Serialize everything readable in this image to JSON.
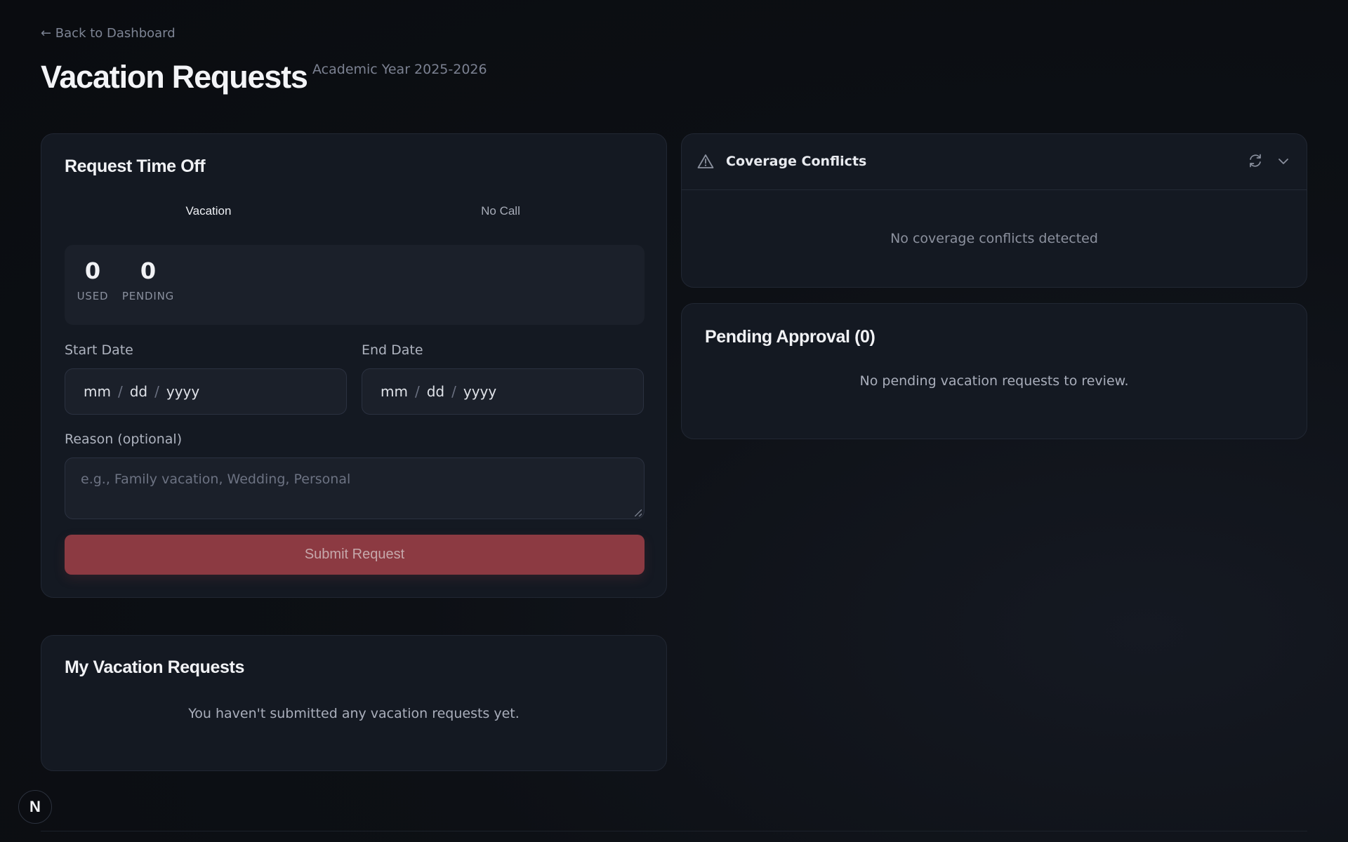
{
  "nav": {
    "back_label": "← Back to Dashboard"
  },
  "header": {
    "title": "Vacation Requests",
    "subtitle": "Academic Year 2025-2026"
  },
  "request_form": {
    "title": "Request Time Off",
    "tabs": [
      {
        "label": "Vacation",
        "active": true
      },
      {
        "label": "No Call",
        "active": false
      }
    ],
    "stats": [
      {
        "value": "0",
        "label": "USED"
      },
      {
        "value": "0",
        "label": "PENDING"
      }
    ],
    "start_date": {
      "label": "Start Date",
      "mm": "mm",
      "dd": "dd",
      "yyyy": "yyyy"
    },
    "end_date": {
      "label": "End Date",
      "mm": "mm",
      "dd": "dd",
      "yyyy": "yyyy"
    },
    "reason": {
      "label": "Reason (optional)",
      "placeholder": "e.g., Family vacation, Wedding, Personal"
    },
    "submit_label": "Submit Request"
  },
  "my_requests": {
    "title": "My Vacation Requests",
    "empty_text": "You haven't submitted any vacation requests yet."
  },
  "coverage_conflicts": {
    "title": "Coverage Conflicts",
    "empty_text": "No coverage conflicts detected",
    "icons": [
      "warning-triangle-icon",
      "refresh-icon",
      "chevron-down-icon"
    ]
  },
  "pending_approval": {
    "title": "Pending Approval (0)",
    "empty_text": "No pending vacation requests to review."
  },
  "badge": {
    "label": "N"
  },
  "colors": {
    "background": "#0b0d12",
    "card": "#141922",
    "input": "#1b202a",
    "submit": "#8c3a42"
  }
}
